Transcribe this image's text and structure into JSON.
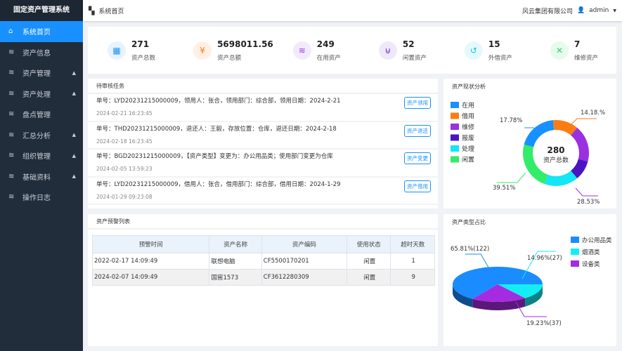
{
  "app": {
    "title": "固定资产管理系统"
  },
  "sidebar": {
    "items": [
      {
        "label": "系统首页",
        "icon": "home-icon",
        "active": true,
        "expand": false
      },
      {
        "label": "资产信息",
        "icon": "layers-icon",
        "expand": false
      },
      {
        "label": "资产管理",
        "icon": "layers-icon",
        "expand": true
      },
      {
        "label": "资产处理",
        "icon": "layers-icon",
        "expand": true
      },
      {
        "label": "盘点管理",
        "icon": "layers-icon",
        "expand": false
      },
      {
        "label": "汇总分析",
        "icon": "layers-icon",
        "expand": true
      },
      {
        "label": "组织管理",
        "icon": "layers-icon",
        "expand": true
      },
      {
        "label": "基础资料",
        "icon": "layers-icon",
        "expand": true
      },
      {
        "label": "操作日志",
        "icon": "layers-icon",
        "expand": false
      }
    ]
  },
  "header": {
    "breadcrumb": "系统首页",
    "company": "风云集团有限公司",
    "user": "admin"
  },
  "stats": [
    {
      "value": "271",
      "label": "资产总数",
      "icon": "grid-icon",
      "color": "#1890ff",
      "bg": "#e8f3ff",
      "glyph": "▦"
    },
    {
      "value": "5698011.56",
      "label": "资产总额",
      "icon": "money-bag-icon",
      "color": "#fa7d14",
      "bg": "#fff0e3",
      "glyph": "¥"
    },
    {
      "value": "249",
      "label": "在用资产",
      "icon": "layers-icon",
      "color": "#9b3be8",
      "bg": "#f3e9fd",
      "glyph": "≋"
    },
    {
      "value": "52",
      "label": "闲置资产",
      "icon": "basket-icon",
      "color": "#5b21c9",
      "bg": "#efe8fb",
      "glyph": "⊍"
    },
    {
      "value": "15",
      "label": "外借资产",
      "icon": "hand-icon",
      "color": "#13c2e6",
      "bg": "#e4f9fd",
      "glyph": "↺"
    },
    {
      "value": "7",
      "label": "维修资产",
      "icon": "wrench-icon",
      "color": "#2fd36a",
      "bg": "#e6fbee",
      "glyph": "✕"
    }
  ],
  "tasks": {
    "title": "待审核任务",
    "items": [
      {
        "text": "单号：LYD20231215000009，领用人：张合，领用部门：综合部，领用日期：2024-2-21",
        "time": "2024-02-21 16:23:45",
        "action": "资产领用"
      },
      {
        "text": "单号：THD20231215000009，退还人：王毅，存放位置：仓库，退还日期：2024-2-18",
        "time": "2024-02-18 16:23:45",
        "action": "资产退还"
      },
      {
        "text": "单号：BGD20231215000009，【资产类型】变更为：办公用品类；使用部门变更为仓库",
        "time": "2024-02-05 13:59:23",
        "action": "资产变更"
      },
      {
        "text": "单号：LYD20231215000009，借用人：张合，借用部门：综合部，借用日期：2024-1-29",
        "time": "2024-01-29 09:23:08",
        "action": "资产借用"
      }
    ]
  },
  "alerts": {
    "title": "资产预警列表",
    "columns": [
      "预警时间",
      "资产名称",
      "资产编码",
      "使用状态",
      "超时天数"
    ],
    "rows": [
      [
        "2022-02-17 14:09:49",
        "联想电脑",
        "CF5500170201",
        "闲置",
        "1"
      ],
      [
        "2024-02-07 14:09:49",
        "国窖1573",
        "CF3612280309",
        "闲置",
        "9"
      ]
    ]
  },
  "chart_data": [
    {
      "type": "pie",
      "variant": "donut",
      "title": "资产现状分析",
      "center_value": "280",
      "center_label": "资产总数",
      "legend_position": "top-left",
      "categories": [
        "在用",
        "借用",
        "维修",
        "报废",
        "处理",
        "闲置"
      ],
      "colors": [
        "#1890ff",
        "#fa7d14",
        "#9b30e0",
        "#4a14c4",
        "#13e6f5",
        "#33ec6a"
      ],
      "values": [
        70,
        45,
        65,
        35,
        60,
        85
      ],
      "data_labels": [
        "17.78%",
        "14.18.%",
        "39.51%",
        "28.53%"
      ]
    },
    {
      "type": "pie",
      "variant": "3d",
      "title": "资产类型占比",
      "legend_position": "top-right",
      "categories": [
        "办公用品类",
        "烟酒类",
        "设备类"
      ],
      "colors": [
        "#1a8cff",
        "#13eef5",
        "#a52be0"
      ],
      "values": [
        122,
        27,
        37
      ],
      "data_labels": [
        "65.81%(122)",
        "14.96%(27)",
        "19.23%(37)"
      ]
    }
  ]
}
